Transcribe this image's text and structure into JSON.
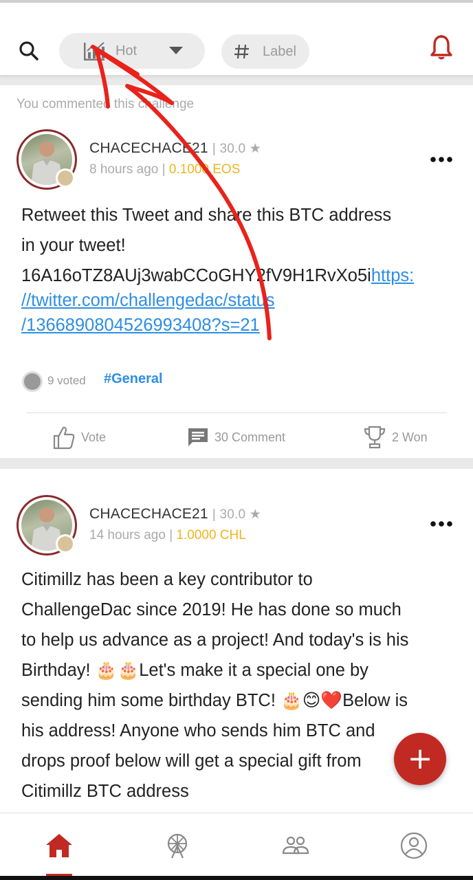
{
  "header": {
    "sort_label": "Hot",
    "label_filter": "Label"
  },
  "posts": [
    {
      "note": "You commented this challenge",
      "username": "CHACECHACE21",
      "rating": "| 30.0 ★",
      "time": "8 hours ago |",
      "reward": "0.1000 EOS",
      "text_lines": [
        "Retweet this Tweet and share this BTC address",
        "in your tweet!",
        "16A16oTZ8AUj3wabCCoGHY2fV9H1RvXo5i"
      ],
      "link_parts": [
        "https:",
        "//twitter.com/challengedac/status",
        "/1366890804526993408?s=21"
      ],
      "voted": "9 voted",
      "tag": "#General",
      "vote_label": "Vote",
      "comment_label": "30 Comment",
      "won_label": "2 Won"
    },
    {
      "username": "CHACECHACE21",
      "rating": "| 30.0 ★",
      "time": "14 hours ago |",
      "reward": "1.0000 CHL",
      "text_lines": [
        "Citimillz has been a key contributor to",
        "ChallengeDac since 2019! He has done so much",
        "to help us advance as a project! And today's is his",
        "Birthday! 🎂🎂Let's make it a special one by",
        "sending him some birthday BTC! 🎂😊❤️Below is",
        "his address! Anyone who sends him BTC and",
        "drops proof below will get a special gift from",
        "Citimillz BTC address"
      ]
    }
  ],
  "colors": {
    "accent": "#c02a22",
    "link": "#2d8ee6",
    "reward": "#f0b41e",
    "annotation": "#e8231b"
  },
  "icons": {
    "search": "search-icon",
    "trend": "trending-chart-icon",
    "dropdown": "caret-down-icon",
    "hash": "hash-icon",
    "bell": "bell-icon",
    "more": "more-horizontal-icon",
    "thumb": "thumbs-up-icon",
    "comment": "comment-icon",
    "trophy": "trophy-icon",
    "home": "home-icon",
    "explore": "ferris-wheel-icon",
    "community": "group-icon",
    "profile": "profile-icon",
    "add": "plus-icon"
  }
}
